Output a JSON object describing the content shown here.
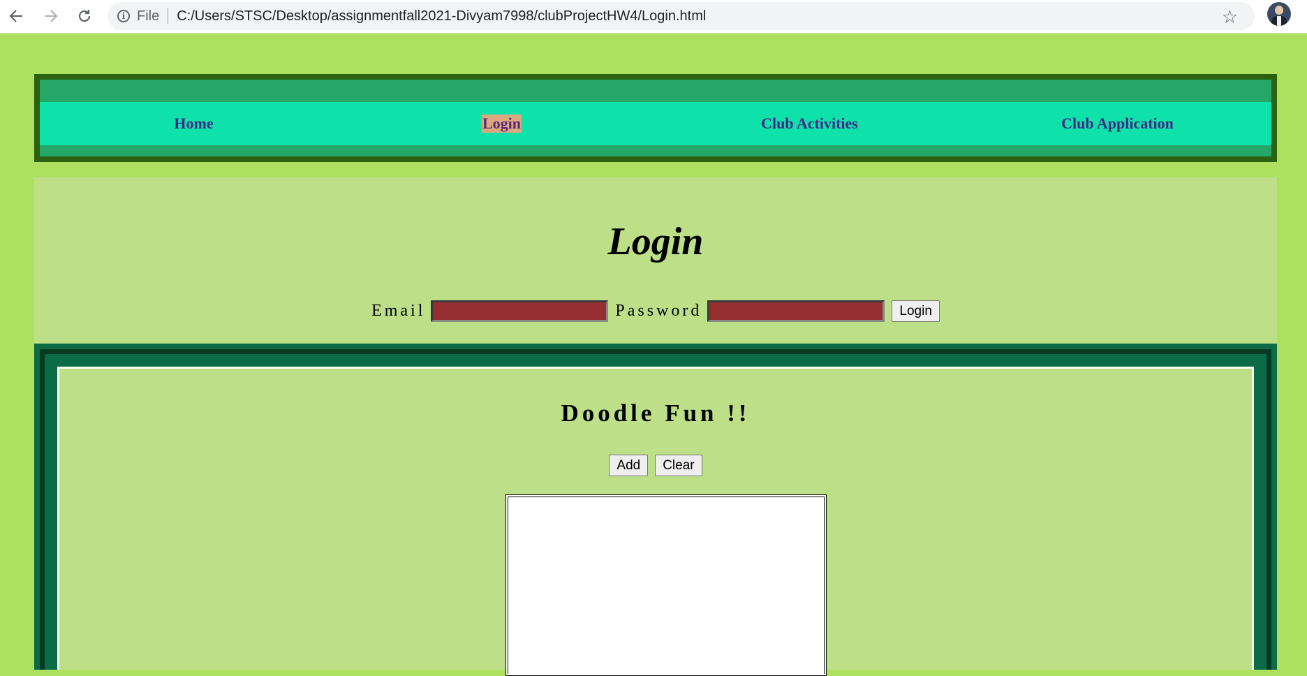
{
  "browser": {
    "file_label": "File",
    "url": "C:/Users/STSC/Desktop/assignmentfall2021-Divyam7998/clubProjectHW4/Login.html",
    "icons": [
      "back-arrow-icon",
      "forward-arrow-icon",
      "reload-icon",
      "info-icon",
      "star-icon",
      "avatar"
    ]
  },
  "nav": {
    "items": [
      {
        "label": "Home"
      },
      {
        "label": "Login"
      },
      {
        "label": "Club Activities"
      },
      {
        "label": "Club Application"
      }
    ],
    "active": "Login"
  },
  "login": {
    "title": "Login",
    "email_label": "Email",
    "password_label": "Password",
    "email_value": "",
    "password_value": "",
    "button_label": "Login"
  },
  "doodle": {
    "title": "Doodle Fun !!",
    "add_label": "Add",
    "clear_label": "Clear"
  },
  "colors": {
    "page_bg": "#ade05e",
    "nav_outer": "#26a76a",
    "nav_band": "#0ee2aa",
    "nav_text": "#3f2a85",
    "active_highlight": "#dca97e",
    "section_bg": "#bcdf87",
    "input_fill": "#952e31",
    "doodle_border": "#0b6b47"
  }
}
